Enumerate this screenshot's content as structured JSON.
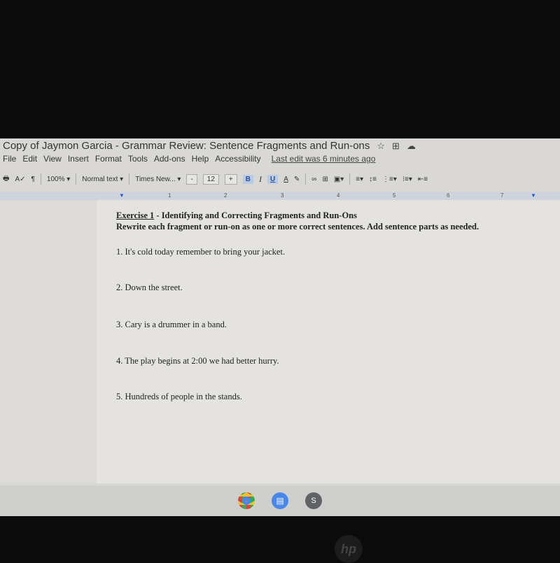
{
  "window": {
    "title": "Copy of Jaymon Garcia - Grammar Review: Sentence Fragments and Run-ons",
    "icons": [
      "star-icon",
      "move-to-folder-icon",
      "cloud-saved-icon"
    ]
  },
  "menu": {
    "items": [
      "File",
      "Edit",
      "View",
      "Insert",
      "Format",
      "Tools",
      "Add-ons",
      "Help",
      "Accessibility"
    ],
    "last_edit": "Last edit was 6 minutes ago"
  },
  "toolbar": {
    "zoom": "100%",
    "style": "Normal text",
    "font": "Times New...",
    "minus": "-",
    "font_size": "12",
    "plus": "+",
    "bold": "B",
    "italic": "I",
    "underline": "U",
    "text_color": "A"
  },
  "ruler": {
    "marks": [
      "1",
      "2",
      "3",
      "4",
      "5",
      "6",
      "7"
    ]
  },
  "document": {
    "heading_link": "Exercise 1",
    "heading_rest": " - Identifying and Correcting Fragments and Run-Ons",
    "instructions": "Rewrite each fragment or run-on as one or more correct sentences. Add sentence parts as needed.",
    "items": [
      "1. It's cold today remember to bring your jacket.",
      "2. Down the street.",
      "3. Cary is a drummer in a band.",
      "4. The play begins at 2:00 we had better hurry.",
      "5. Hundreds of people in the stands."
    ]
  },
  "shelf": {
    "apps": [
      "chrome-icon",
      "google-docs-icon",
      "slides-icon"
    ],
    "slides_letter": "S"
  },
  "bezel": {
    "logo": "hp"
  }
}
